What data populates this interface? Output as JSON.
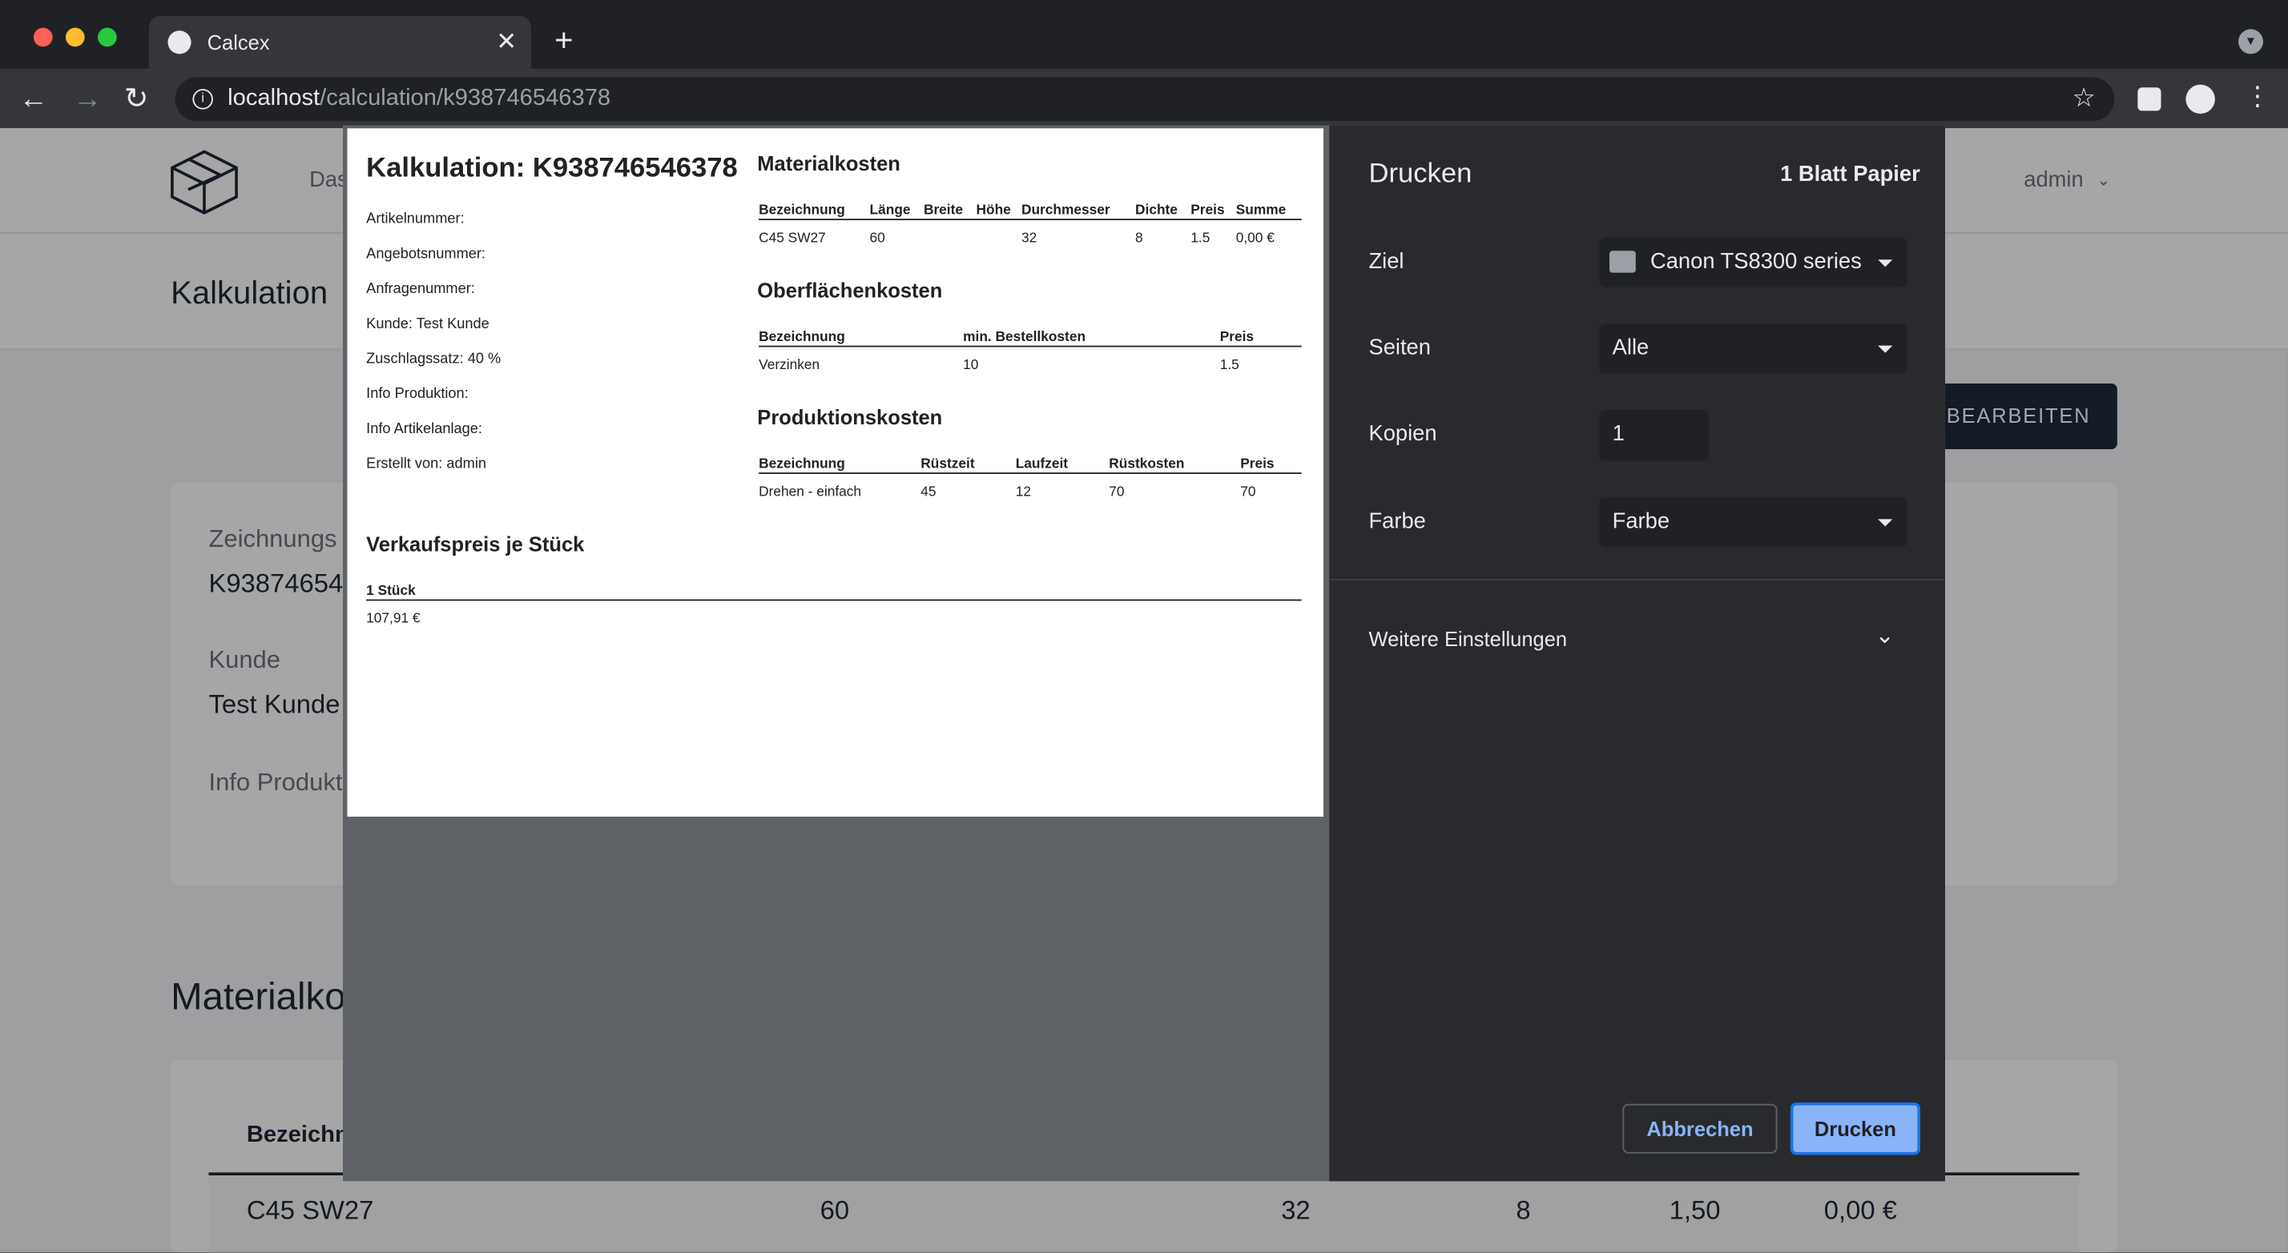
{
  "browser": {
    "tab_title": "Calcex",
    "url_host": "localhost",
    "url_path": "/calculation/k938746546378"
  },
  "app": {
    "nav_item_partial": "Das",
    "user": "admin",
    "page_title": "Kalkulation",
    "edit_button": "BEARBEITEN",
    "info_labels": {
      "drawing": "Zeichnungs",
      "drawing_value": "K93874654",
      "customer": "Kunde",
      "customer_value": "Test Kunde",
      "production": "Info Produkt"
    },
    "section_material": "Materialko",
    "material_table": {
      "header_first": "Bezeichn",
      "row": [
        "C45 SW27",
        "60",
        "32",
        "8",
        "1,50",
        "0,00 €"
      ]
    }
  },
  "print_preview": {
    "title": "Kalkulation: K938746546378",
    "fields": [
      "Artikelnummer:",
      "Angebotsnummer:",
      "Anfragenummer:",
      "Kunde: Test Kunde",
      "Zuschlagssatz: 40 %",
      "Info Produktion:",
      "Info Artikelanlage:",
      "Erstellt von: admin"
    ],
    "sale_title": "Verkaufspreis je Stück",
    "sale_header": "1 Stück",
    "sale_value": "107,91 €",
    "material": {
      "title": "Materialkosten",
      "headers": [
        "Bezeichnung",
        "Länge",
        "Breite",
        "Höhe",
        "Durchmesser",
        "Dichte",
        "Preis",
        "Summe"
      ],
      "row": [
        "C45 SW27",
        "60",
        "",
        "",
        "32",
        "8",
        "1.5",
        "0,00 €"
      ]
    },
    "surface": {
      "title": "Oberflächenkosten",
      "headers": [
        "Bezeichnung",
        "min. Bestellkosten",
        "Preis"
      ],
      "row": [
        "Verzinken",
        "10",
        "1.5"
      ]
    },
    "production": {
      "title": "Produktionskosten",
      "headers": [
        "Bezeichnung",
        "Rüstzeit",
        "Laufzeit",
        "Rüstkosten",
        "Preis"
      ],
      "row": [
        "Drehen - einfach",
        "45",
        "12",
        "70",
        "70"
      ]
    }
  },
  "print_dialog": {
    "title": "Drucken",
    "sheet_count": "1 Blatt Papier",
    "destination_label": "Ziel",
    "destination_value": "Canon TS8300 series",
    "pages_label": "Seiten",
    "pages_value": "Alle",
    "copies_label": "Kopien",
    "copies_value": "1",
    "color_label": "Farbe",
    "color_value": "Farbe",
    "more_settings": "Weitere Einstellungen",
    "cancel_button": "Abbrechen",
    "print_button": "Drucken"
  },
  "colors": {
    "primary_button": "#8ab4f8",
    "edit_button_bg": "#1f2a3c",
    "dialog_panel": "#292a2d"
  }
}
